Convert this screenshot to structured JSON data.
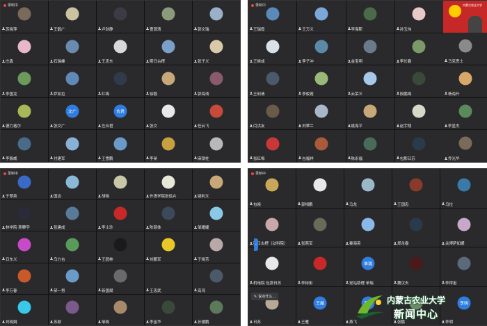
{
  "recording_label": "录制中",
  "panels": [
    {
      "id": "top-left",
      "participants": [
        {
          "name": "苏晓萍",
          "avatar": "#7a6a5a"
        },
        {
          "name": "王鹤广",
          "avatar": "#c9c3a2"
        },
        {
          "name": "卢剑静",
          "avatar": "#3b3b46"
        },
        {
          "name": "曹源清",
          "avatar": "#8a9a7a"
        },
        {
          "name": "郭文瑞",
          "avatar": "#9ab0c8"
        },
        {
          "name": "庄鑫",
          "avatar": "#e8b8c8"
        },
        {
          "name": "石瑞峰",
          "avatar": "#6a8ab0"
        },
        {
          "name": "王忠东",
          "avatar": "#d8d8d8"
        },
        {
          "name": "斯日古楞",
          "avatar": "#7aa0c8"
        },
        {
          "name": "张子义",
          "avatar": "#d9c9a8"
        },
        {
          "name": "李国龙",
          "avatar": "#6c9a5a"
        },
        {
          "name": "萨如拉",
          "avatar": "#5f8ab8"
        },
        {
          "name": "红梅",
          "avatar": "#2f3a4a"
        },
        {
          "name": "徐毅",
          "avatar": "#c8a878"
        },
        {
          "name": "郭海涛",
          "avatar": "#8a5a6a"
        },
        {
          "name": "德力格尔",
          "avatar": "#a8b858"
        },
        {
          "name": "张文广",
          "avatar": "",
          "text": "文广"
        },
        {
          "name": "左合君",
          "avatar": "",
          "text": "合君"
        },
        {
          "name": "张文",
          "avatar": "#e8e8e8"
        },
        {
          "name": "任云飞",
          "avatar": "#c84a3a"
        },
        {
          "name": "李振威",
          "avatar": "#4a6a8a"
        },
        {
          "name": "付建军",
          "avatar": "#8ab0d8"
        },
        {
          "name": "王雪鹏",
          "avatar": "#6a9ac8"
        },
        {
          "name": "李昊",
          "avatar": "#c8a040"
        },
        {
          "name": "麻锁柱",
          "avatar": "#b8b8b8"
        }
      ]
    },
    {
      "id": "top-right",
      "speaker_banner": "内蒙古农业大学",
      "participants": [
        {
          "name": "王瑞霞",
          "avatar": "#5a8ab8"
        },
        {
          "name": "王万义",
          "avatar": "#7aa8d8"
        },
        {
          "name": "李海斯",
          "avatar": "#4a6a4a"
        },
        {
          "name": "孙玉伟",
          "avatar": "#e8c8c8"
        },
        {
          "name": "王继成",
          "avatar": "#d8e0e8"
        },
        {
          "name": "李子冲",
          "avatar": "#5a8aa8"
        },
        {
          "name": "金宝明",
          "avatar": "#6a7a8a"
        },
        {
          "name": "李长春",
          "avatar": "#7a9a6a"
        },
        {
          "name": "王利清",
          "avatar": "#4a5a6a"
        },
        {
          "name": "李俊霞",
          "avatar": "#9ab878"
        },
        {
          "name": "云荣义",
          "avatar": "#a8c8e8"
        },
        {
          "name": "段鹏梅",
          "avatar": "#3a4a3a"
        },
        {
          "name": "闫洪友",
          "avatar": "#6a5a4a"
        },
        {
          "name": "刘翠兰",
          "avatar": "#a8b8c8"
        },
        {
          "name": "姚海平",
          "avatar": "#c8a878"
        },
        {
          "name": "赵宇翔",
          "avatar": "#d8d8c8"
        },
        {
          "name": "张红梅",
          "avatar": "#c83838"
        },
        {
          "name": "包福祥",
          "avatar": "#a85a3a"
        },
        {
          "name": "陈永福",
          "avatar": "#4a6a5a"
        },
        {
          "name": "包那日苏",
          "avatar": "#2a3a4a"
        },
        {
          "name": "马克思士",
          "avatar": "#8a8a8a"
        },
        {
          "name": "杨海升",
          "avatar": "#d8a868"
        },
        {
          "name": "李显杰",
          "avatar": "#5a8a5a"
        },
        {
          "name": "乔光华",
          "avatar": "#7a6a5a"
        }
      ]
    },
    {
      "id": "bottom-left",
      "participants": [
        {
          "name": "于翠英",
          "avatar": "#3a6ac8"
        },
        {
          "name": "国洁",
          "avatar": "#8ab8d8"
        },
        {
          "name": "胡晓",
          "avatar": "#c8c8a8"
        },
        {
          "name": "外语学院张佳卉",
          "avatar": "#e8e8d8"
        },
        {
          "name": "姚利文",
          "avatar": "#c8a878"
        },
        {
          "name": "林学院 燕攀宇",
          "avatar": "#2a2a3a"
        },
        {
          "name": "张建成",
          "avatar": "#5a7a9a"
        },
        {
          "name": "李士珍",
          "avatar": "#c82828"
        },
        {
          "name": "陈慈体",
          "avatar": "#3a4a5a"
        },
        {
          "name": "邹耀婕",
          "avatar": "#8ac8e8"
        },
        {
          "name": "日东义",
          "avatar": "#c84ac8"
        },
        {
          "name": "乌力吉",
          "avatar": "#5a9a5a"
        },
        {
          "name": "王园林",
          "avatar": "#1a1a1a"
        },
        {
          "name": "刘鹏军",
          "avatar": "#e8c828"
        },
        {
          "name": "于晓芳",
          "avatar": "#b8a8a8"
        },
        {
          "name": "李万春",
          "avatar": "#c85a2a"
        },
        {
          "name": "郝一男",
          "avatar": "#6a9ac8"
        },
        {
          "name": "新国斌",
          "avatar": "#6a6a6a"
        },
        {
          "name": "王忠武",
          "avatar": "#2a2a2a"
        },
        {
          "name": "高鸿",
          "avatar": "#4a5a6a"
        },
        {
          "name": "刘晓娟",
          "avatar": "#38c8e8"
        },
        {
          "name": "苏颖",
          "avatar": "#7a5a8a"
        },
        {
          "name": "邹晓",
          "avatar": "#a88a6a"
        },
        {
          "name": "李金华",
          "avatar": "#3a4a3a"
        },
        {
          "name": "孙德鹏",
          "avatar": "#5a7a5a"
        }
      ]
    },
    {
      "id": "bottom-right",
      "participants": [
        {
          "name": "包晓",
          "avatar": "#c8a858"
        },
        {
          "name": "郭相鹏",
          "avatar": "#e8e8e8"
        },
        {
          "name": "马龙",
          "avatar": "#9ab8c8"
        },
        {
          "name": "王国忠",
          "avatar": "#8a3a2a"
        },
        {
          "name": "乌拉",
          "avatar": "#3a7aa8"
        },
        {
          "name": "斯日古楞（动科院）",
          "avatar": "#c8a8a8"
        },
        {
          "name": "张燕军",
          "avatar": "#6a6a5a"
        },
        {
          "name": "秦海英",
          "avatar": "#8ab8e8"
        },
        {
          "name": "郑永春",
          "avatar": "#2a3a4a"
        },
        {
          "name": "关博萨如娜",
          "avatar": "#c8a8c8"
        },
        {
          "name": "机电院 包那日苏",
          "avatar": "#e8e8e8"
        },
        {
          "name": "李彬彬",
          "avatar": "#c82828"
        },
        {
          "name": "党站助理 单瑞",
          "avatar": "",
          "text": "单瑞"
        },
        {
          "name": "魏汉夫",
          "avatar": "#4a1a1a"
        },
        {
          "name": "李得宙",
          "avatar": "#5a6a7a"
        },
        {
          "name": "日苏",
          "avatar": "#b8a898"
        },
        {
          "name": "王雁",
          "avatar": "",
          "text": "王雁"
        },
        {
          "name": "燕飞",
          "avatar": "",
          "text": "燕飞"
        },
        {
          "name": "张鹏",
          "avatar": "#6a8a6a"
        },
        {
          "name": "李明",
          "avatar": "",
          "text": "李明"
        }
      ],
      "chat_popup": "说点什么…",
      "side_tab": "‹"
    }
  ],
  "watermark": {
    "line1": "内蒙古农业大学",
    "line2": "新闻中心",
    "brand_color": "#1a5f2f",
    "accent_color": "#6fb82e"
  }
}
